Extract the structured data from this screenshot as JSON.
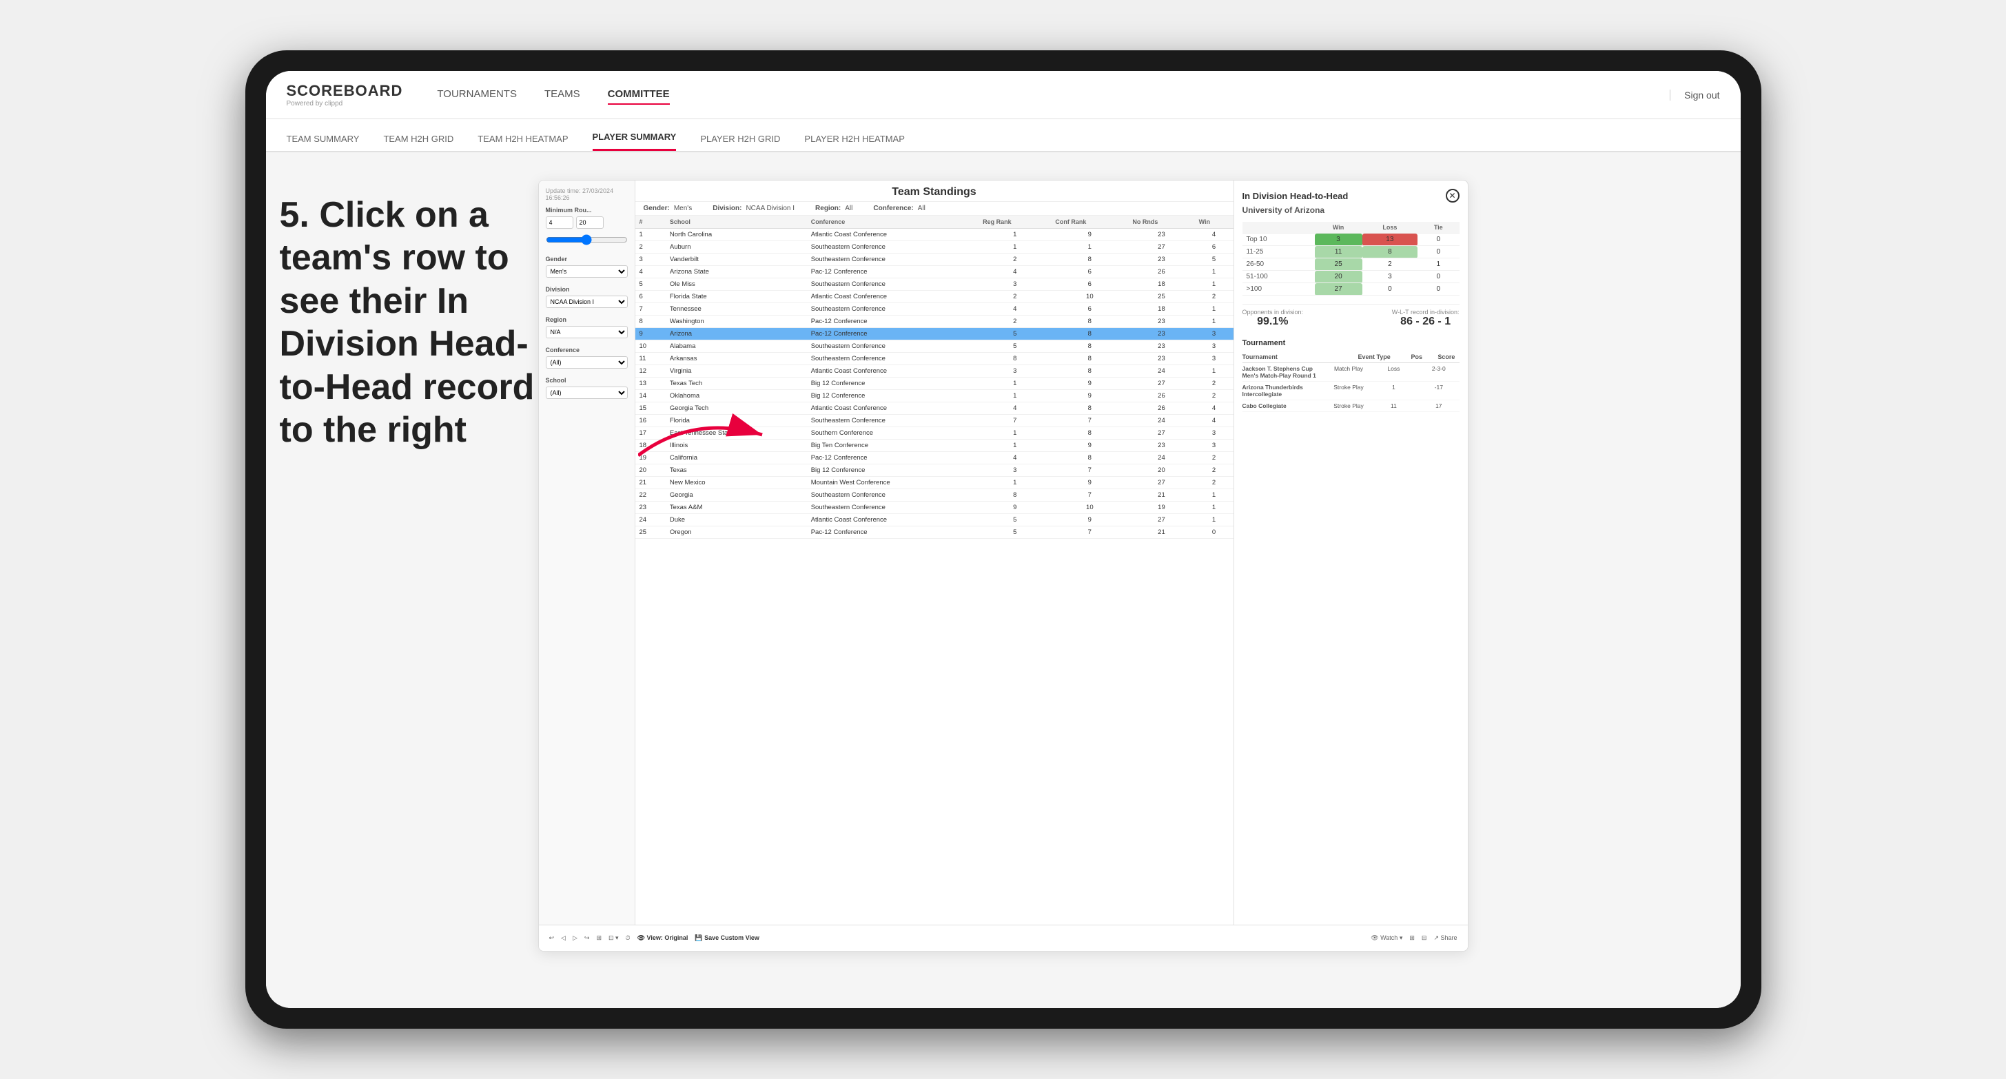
{
  "device": {
    "frame_bg": "#1a1a1a",
    "screen_bg": "#fff"
  },
  "top_nav": {
    "logo": "SCOREBOARD",
    "logo_sub": "Powered by clippd",
    "nav_items": [
      "TOURNAMENTS",
      "TEAMS",
      "COMMITTEE"
    ],
    "active_nav": "COMMITTEE",
    "sign_out": "Sign out"
  },
  "sub_nav": {
    "items": [
      "TEAM SUMMARY",
      "TEAM H2H GRID",
      "TEAM H2H HEATMAP",
      "PLAYER SUMMARY",
      "PLAYER H2H GRID",
      "PLAYER H2H HEATMAP"
    ],
    "active": "PLAYER SUMMARY"
  },
  "instruction": {
    "text": "5. Click on a team's row to see their In Division Head-to-Head record to the right"
  },
  "panel": {
    "update_time": "Update time: 27/03/2024 16:56:26",
    "title": "Team Standings",
    "gender_label": "Gender:",
    "gender_value": "Men's",
    "division_label": "Division:",
    "division_value": "NCAA Division I",
    "region_label": "Region:",
    "region_value": "All",
    "conference_label": "Conference:",
    "conference_value": "All",
    "filters": {
      "min_rounds_label": "Minimum Rou...",
      "min_rounds_val1": "4",
      "min_rounds_val2": "20",
      "gender_label": "Gender",
      "gender_value": "Men's",
      "division_label": "Division",
      "division_value": "NCAA Division I",
      "region_label": "Region",
      "region_value": "N/A",
      "conference_label": "Conference",
      "conference_value": "(All)",
      "school_label": "School",
      "school_value": "(All)"
    },
    "table_headers": [
      "#",
      "School",
      "Conference",
      "Reg Rank",
      "Conf Rank",
      "No Rnds",
      "Win"
    ],
    "table_rows": [
      {
        "num": 1,
        "school": "North Carolina",
        "conference": "Atlantic Coast Conference",
        "reg_rank": 1,
        "conf_rank": 9,
        "no_rnds": 23,
        "win": 4
      },
      {
        "num": 2,
        "school": "Auburn",
        "conference": "Southeastern Conference",
        "reg_rank": 1,
        "conf_rank": 1,
        "no_rnds": 27,
        "win": 6
      },
      {
        "num": 3,
        "school": "Vanderbilt",
        "conference": "Southeastern Conference",
        "reg_rank": 2,
        "conf_rank": 8,
        "no_rnds": 23,
        "win": 5
      },
      {
        "num": 4,
        "school": "Arizona State",
        "conference": "Pac-12 Conference",
        "reg_rank": 4,
        "conf_rank": 6,
        "no_rnds": 26,
        "win": 1
      },
      {
        "num": 5,
        "school": "Ole Miss",
        "conference": "Southeastern Conference",
        "reg_rank": 3,
        "conf_rank": 6,
        "no_rnds": 18,
        "win": 1
      },
      {
        "num": 6,
        "school": "Florida State",
        "conference": "Atlantic Coast Conference",
        "reg_rank": 2,
        "conf_rank": 10,
        "no_rnds": 25,
        "win": 2
      },
      {
        "num": 7,
        "school": "Tennessee",
        "conference": "Southeastern Conference",
        "reg_rank": 4,
        "conf_rank": 6,
        "no_rnds": 18,
        "win": 1
      },
      {
        "num": 8,
        "school": "Washington",
        "conference": "Pac-12 Conference",
        "reg_rank": 2,
        "conf_rank": 8,
        "no_rnds": 23,
        "win": 1
      },
      {
        "num": 9,
        "school": "Arizona",
        "conference": "Pac-12 Conference",
        "reg_rank": 5,
        "conf_rank": 8,
        "no_rnds": 23,
        "win": 3,
        "highlighted": true
      },
      {
        "num": 10,
        "school": "Alabama",
        "conference": "Southeastern Conference",
        "reg_rank": 5,
        "conf_rank": 8,
        "no_rnds": 23,
        "win": 3
      },
      {
        "num": 11,
        "school": "Arkansas",
        "conference": "Southeastern Conference",
        "reg_rank": 8,
        "conf_rank": 8,
        "no_rnds": 23,
        "win": 3
      },
      {
        "num": 12,
        "school": "Virginia",
        "conference": "Atlantic Coast Conference",
        "reg_rank": 3,
        "conf_rank": 8,
        "no_rnds": 24,
        "win": 1
      },
      {
        "num": 13,
        "school": "Texas Tech",
        "conference": "Big 12 Conference",
        "reg_rank": 1,
        "conf_rank": 9,
        "no_rnds": 27,
        "win": 2
      },
      {
        "num": 14,
        "school": "Oklahoma",
        "conference": "Big 12 Conference",
        "reg_rank": 1,
        "conf_rank": 9,
        "no_rnds": 26,
        "win": 2
      },
      {
        "num": 15,
        "school": "Georgia Tech",
        "conference": "Atlantic Coast Conference",
        "reg_rank": 4,
        "conf_rank": 8,
        "no_rnds": 26,
        "win": 4
      },
      {
        "num": 16,
        "school": "Florida",
        "conference": "Southeastern Conference",
        "reg_rank": 7,
        "conf_rank": 7,
        "no_rnds": 24,
        "win": 4
      },
      {
        "num": 17,
        "school": "East Tennessee State",
        "conference": "Southern Conference",
        "reg_rank": 1,
        "conf_rank": 8,
        "no_rnds": 27,
        "win": 3
      },
      {
        "num": 18,
        "school": "Illinois",
        "conference": "Big Ten Conference",
        "reg_rank": 1,
        "conf_rank": 9,
        "no_rnds": 23,
        "win": 3
      },
      {
        "num": 19,
        "school": "California",
        "conference": "Pac-12 Conference",
        "reg_rank": 4,
        "conf_rank": 8,
        "no_rnds": 24,
        "win": 2
      },
      {
        "num": 20,
        "school": "Texas",
        "conference": "Big 12 Conference",
        "reg_rank": 3,
        "conf_rank": 7,
        "no_rnds": 20,
        "win": 2
      },
      {
        "num": 21,
        "school": "New Mexico",
        "conference": "Mountain West Conference",
        "reg_rank": 1,
        "conf_rank": 9,
        "no_rnds": 27,
        "win": 2
      },
      {
        "num": 22,
        "school": "Georgia",
        "conference": "Southeastern Conference",
        "reg_rank": 8,
        "conf_rank": 7,
        "no_rnds": 21,
        "win": 1
      },
      {
        "num": 23,
        "school": "Texas A&M",
        "conference": "Southeastern Conference",
        "reg_rank": 9,
        "conf_rank": 10,
        "no_rnds": 19,
        "win": 1
      },
      {
        "num": 24,
        "school": "Duke",
        "conference": "Atlantic Coast Conference",
        "reg_rank": 5,
        "conf_rank": 9,
        "no_rnds": 27,
        "win": 1
      },
      {
        "num": 25,
        "school": "Oregon",
        "conference": "Pac-12 Conference",
        "reg_rank": 5,
        "conf_rank": 7,
        "no_rnds": 21,
        "win": 0
      }
    ],
    "h2h": {
      "title": "In Division Head-to-Head",
      "team": "University of Arizona",
      "headers": [
        "",
        "Win",
        "Loss",
        "Tie"
      ],
      "rows": [
        {
          "label": "Top 10",
          "win": 3,
          "loss": 13,
          "tie": 0,
          "win_color": "green",
          "loss_color": "red"
        },
        {
          "label": "11-25",
          "win": 11,
          "loss": 8,
          "tie": 0,
          "win_color": "light-green",
          "loss_color": "light-green"
        },
        {
          "label": "26-50",
          "win": 25,
          "loss": 2,
          "tie": 1,
          "win_color": "light-green",
          "loss_color": ""
        },
        {
          "label": "51-100",
          "win": 20,
          "loss": 3,
          "tie": 0,
          "win_color": "light-green",
          "loss_color": ""
        },
        {
          "label": ">100",
          "win": 27,
          "loss": 0,
          "tie": 0,
          "win_color": "light-green",
          "loss_color": ""
        }
      ],
      "opponents_label": "Opponents in division:",
      "opponents_value": "99.1%",
      "record_label": "W-L-T record in-division:",
      "record_value": "86 - 26 - 1",
      "tournaments_label": "Tournament",
      "tournaments_headers": [
        "Tournament",
        "Event Type",
        "Pos",
        "Score"
      ],
      "tournaments": [
        {
          "name": "Jackson T. Stephens Cup Men's Match-Play Round 1",
          "type": "Match Play",
          "pos": "Loss",
          "score": "2-3-0"
        },
        {
          "name": "Arizona Thunderbirds Intercollegiate",
          "type": "Stroke Play",
          "pos": "1",
          "score": "-17"
        },
        {
          "name": "Cabo Collegiate",
          "type": "Stroke Play",
          "pos": "11",
          "score": "17"
        }
      ]
    },
    "toolbar": {
      "undo": "↩",
      "redo": "↪",
      "view_original": "View: Original",
      "save_custom": "Save Custom View",
      "watch": "Watch",
      "share": "Share"
    }
  }
}
